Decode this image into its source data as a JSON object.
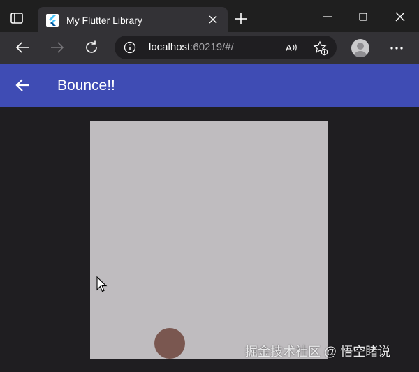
{
  "browser": {
    "tab": {
      "title": "My Flutter Library"
    },
    "address": {
      "host": "localhost",
      "rest": ":60219/#/"
    },
    "icons": {
      "tab_actions": "tab-actions-icon",
      "favicon": "flutter-logo-icon",
      "tab_close": "close-icon",
      "new_tab": "plus-icon",
      "minimize": "minimize-icon",
      "maximize": "maximize-icon",
      "close_window": "close-icon",
      "back": "arrow-left-icon",
      "forward": "arrow-right-icon",
      "refresh": "refresh-icon",
      "site_info": "info-icon",
      "read_aloud": "read-aloud-icon",
      "favorites": "star-plus-icon",
      "profile": "profile-avatar-icon",
      "more": "more-dots-icon"
    }
  },
  "app": {
    "title": "Bounce!!",
    "back_icon": "arrow-left-icon",
    "colors": {
      "appbar": "#3f4cb4",
      "canvas": "#bfbcbf",
      "ball": "#7a5750",
      "page_bg": "#1f1e21"
    }
  },
  "watermark": "掘金技术社区 @ 悟空睹说"
}
